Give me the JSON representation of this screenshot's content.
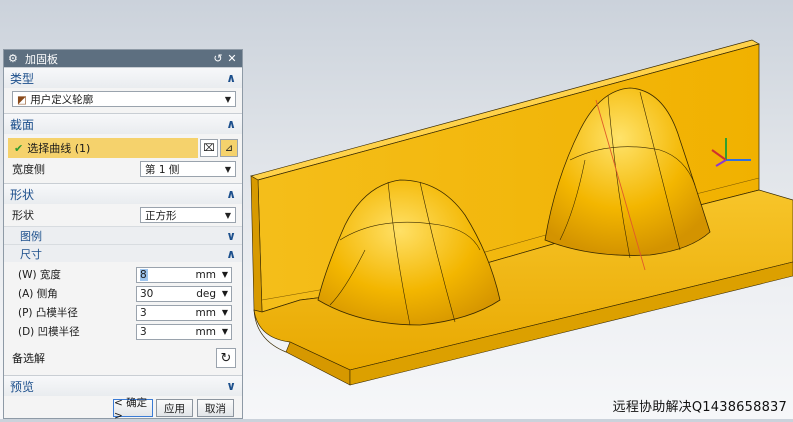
{
  "dialog": {
    "title": "加固板",
    "sections": {
      "type": {
        "label": "类型",
        "selected": "用户定义轮廓"
      },
      "section": {
        "label": "截面",
        "select_curve": "选择曲线 (1)",
        "width_side_label": "宽度侧",
        "width_side_value": "第 1 侧"
      },
      "shape": {
        "label": "形状",
        "shape_label": "形状",
        "shape_value": "正方形",
        "legend_label": "图例",
        "dimensions_label": "尺寸",
        "fields": [
          {
            "label": "(W) 宽度",
            "value": "8",
            "unit": "mm"
          },
          {
            "label": "(A) 侧角",
            "value": "30",
            "unit": "deg"
          },
          {
            "label": "(P) 凸模半径",
            "value": "3",
            "unit": "mm"
          },
          {
            "label": "(D) 凹模半径",
            "value": "3",
            "unit": "mm"
          }
        ],
        "alternate_label": "备选解"
      },
      "preview": {
        "label": "预览"
      }
    },
    "buttons": {
      "ok": "< 确定 >",
      "apply": "应用",
      "cancel": "取消"
    }
  },
  "watermark": "远程协助解决Q1438658837",
  "colors": {
    "titlebar": "#5d6f80",
    "part": "#f2b600",
    "highlight": "#f5d26c",
    "section_text": "#1c4f8c"
  },
  "icons": [
    "gear-icon",
    "reset-icon",
    "close-icon",
    "chevron-up-icon",
    "chevron-down-icon",
    "check-icon",
    "curve-select-icon",
    "sketch-icon",
    "alternate-solution-icon",
    "dropdown-arrow-icon",
    "profile-type-icon"
  ]
}
